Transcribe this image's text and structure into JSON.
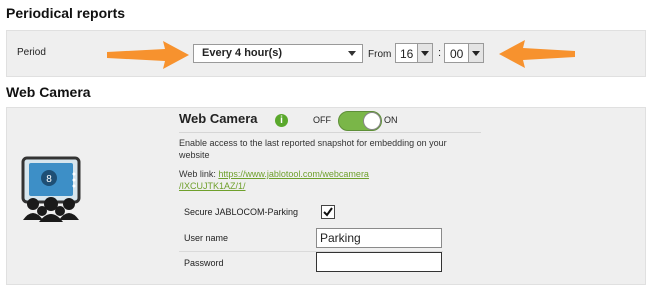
{
  "periodical": {
    "title": "Periodical reports",
    "period_label": "Period",
    "period_value": "Every 4 hour(s)",
    "from_label": "From",
    "hour": "16",
    "separator": ":",
    "minute": "00"
  },
  "webcam": {
    "section_title": "Web Camera",
    "heading": "Web Camera",
    "info_icon_glyph": "i",
    "toggle_off": "OFF",
    "toggle_on": "ON",
    "description": "Enable access to the last reported snapshot for embedding on your website",
    "weblink_label": "Web link:",
    "weblink_line1": "https://www.jablotool.com/webcamera",
    "weblink_line2": "/IXCUJTK1AZ/1/",
    "secure_label": "Secure JABLOCOM-Parking",
    "secure_checked": true,
    "username_label": "User name",
    "username_value": "Parking",
    "password_label": "Password",
    "password_value": ""
  },
  "colors": {
    "arrow": "#f7922e",
    "toggle_green": "#7ab648",
    "link": "#6fa02c",
    "info_green": "#5aa82c"
  }
}
